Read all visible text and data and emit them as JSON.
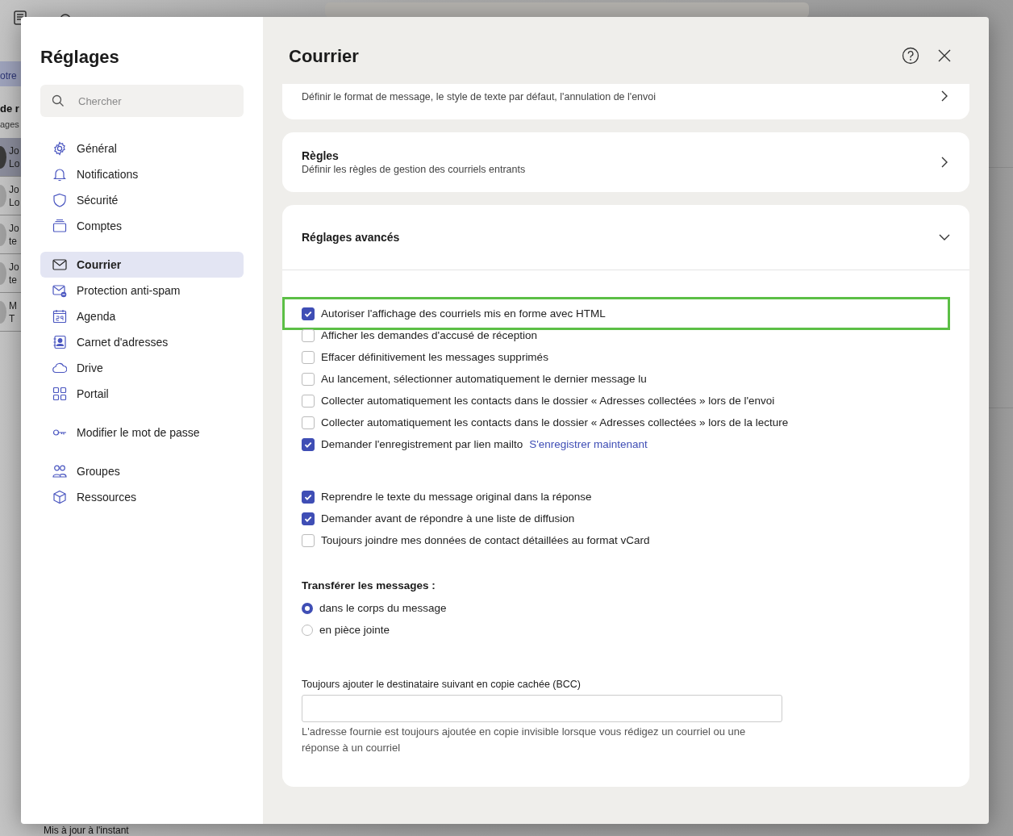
{
  "background": {
    "fragments": [
      {
        "kind": "pill",
        "text": "otre"
      },
      {
        "kind": "bold",
        "text": "de r"
      },
      {
        "kind": "plain",
        "text": "ages"
      }
    ],
    "rows": [
      {
        "lines": [
          "Jo",
          "Lo"
        ],
        "selected": true
      },
      {
        "lines": [
          "Jo",
          "Lo"
        ],
        "selected": false
      },
      {
        "lines": [
          "Jo",
          "te"
        ],
        "selected": false
      },
      {
        "lines": [
          "Jo",
          "te"
        ],
        "selected": false
      },
      {
        "lines": [
          "M",
          "T"
        ],
        "selected": false
      }
    ],
    "status": "Mis à jour à l'instant"
  },
  "sidebar": {
    "title": "Réglages",
    "search": {
      "placeholder": "Chercher"
    },
    "groups": [
      [
        {
          "label": "Général",
          "selected": false
        },
        {
          "label": "Notifications",
          "selected": false
        },
        {
          "label": "Sécurité",
          "selected": false
        },
        {
          "label": "Comptes",
          "selected": false
        }
      ],
      [
        {
          "label": "Courrier",
          "selected": true
        },
        {
          "label": "Protection anti-spam",
          "selected": false
        },
        {
          "label": "Agenda",
          "selected": false
        },
        {
          "label": "Carnet d'adresses",
          "selected": false
        },
        {
          "label": "Drive",
          "selected": false
        },
        {
          "label": "Portail",
          "selected": false
        }
      ],
      [
        {
          "label": "Modifier le mot de passe",
          "selected": false
        }
      ],
      [
        {
          "label": "Groupes",
          "selected": false
        },
        {
          "label": "Ressources",
          "selected": false
        }
      ]
    ]
  },
  "main": {
    "title": "Courrier",
    "cards": [
      {
        "kind": "link",
        "description": "Définir le format de message, le style de texte par défaut, l'annulation de l'envoi"
      },
      {
        "kind": "link",
        "title": "Règles",
        "description": "Définir les règles de gestion des courriels entrants"
      }
    ],
    "advanced": {
      "title": "Réglages avancés",
      "expanded": true,
      "option_groups": [
        [
          {
            "label": "Autoriser l'affichage des courriels mis en forme avec HTML",
            "checked": true,
            "highlighted": true
          },
          {
            "label": "Afficher les demandes d'accusé de réception",
            "checked": false,
            "highlighted": false
          },
          {
            "label": "Effacer définitivement les messages supprimés",
            "checked": false,
            "highlighted": false
          },
          {
            "label": "Au lancement, sélectionner automatiquement le dernier message lu",
            "checked": false,
            "highlighted": false
          },
          {
            "label": "Collecter automatiquement les contacts dans le dossier « Adresses collectées » lors de l'envoi",
            "checked": false,
            "highlighted": false
          },
          {
            "label": "Collecter automatiquement les contacts dans le dossier « Adresses collectées » lors de la lecture",
            "checked": false,
            "highlighted": false
          },
          {
            "label": "Demander l'enregistrement par lien mailto",
            "checked": true,
            "highlighted": false,
            "link": "S'enregistrer maintenant"
          }
        ],
        [
          {
            "label": "Reprendre le texte du message original dans la réponse",
            "checked": true,
            "highlighted": false
          },
          {
            "label": "Demander avant de répondre à une liste de diffusion",
            "checked": true,
            "highlighted": false
          },
          {
            "label": "Toujours joindre mes données de contact détaillées au format vCard",
            "checked": false,
            "highlighted": false
          }
        ]
      ],
      "forward": {
        "label": "Transférer les messages :",
        "options": [
          {
            "label": "dans le corps du message",
            "selected": true
          },
          {
            "label": "en pièce jointe",
            "selected": false
          }
        ]
      },
      "bcc": {
        "label": "Toujours ajouter le destinataire suivant en copie cachée (BCC)",
        "help": "L'adresse fournie est toujours ajoutée en copie invisible lorsque vous rédigez un courriel ou une réponse à un courriel"
      }
    }
  }
}
